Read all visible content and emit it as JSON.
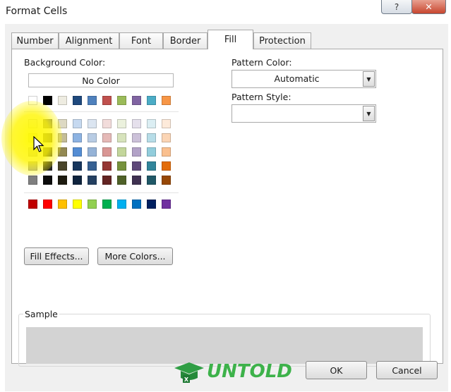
{
  "window": {
    "title": "Format Cells",
    "help_label": "?",
    "close_label": "✕"
  },
  "tabs": [
    {
      "label": "Number",
      "active": false
    },
    {
      "label": "Alignment",
      "active": false
    },
    {
      "label": "Font",
      "active": false
    },
    {
      "label": "Border",
      "active": false
    },
    {
      "label": "Fill",
      "active": true
    },
    {
      "label": "Protection",
      "active": false
    }
  ],
  "fill": {
    "background_color_label": "Background Color:",
    "no_color_label": "No Color",
    "theme_colors_top": [
      "#ffffff",
      "#000000",
      "#eeece1",
      "#1f497d",
      "#4f81bd",
      "#c0504d",
      "#9bbb59",
      "#8064a2",
      "#4bacc6",
      "#f79646"
    ],
    "theme_shades": [
      [
        "#f2f2f2",
        "#7f7f7f",
        "#ddd9c3",
        "#c6d9f0",
        "#dbe5f1",
        "#f2dcdb",
        "#ebf1dd",
        "#e5e0ec",
        "#dbeef3",
        "#fdeada"
      ],
      [
        "#d8d8d8",
        "#595959",
        "#c4bd97",
        "#8db3e2",
        "#b8cce4",
        "#e5b9b7",
        "#d7e3bc",
        "#ccc1d9",
        "#b7dde8",
        "#fbd5b5"
      ],
      [
        "#bfbfbf",
        "#3f3f3f",
        "#938953",
        "#548dd4",
        "#95b3d7",
        "#d99694",
        "#c3d69b",
        "#b2a2c7",
        "#92cddc",
        "#fac08f"
      ],
      [
        "#a5a5a5",
        "#262626",
        "#494429",
        "#17365d",
        "#366092",
        "#953734",
        "#76923c",
        "#5f497a",
        "#31859b",
        "#e36c09"
      ],
      [
        "#7f7f7f",
        "#0c0c0c",
        "#1d1b10",
        "#0f243e",
        "#244061",
        "#632423",
        "#4f6128",
        "#3f3151",
        "#205867",
        "#974806"
      ]
    ],
    "standard_colors": [
      "#c00000",
      "#ff0000",
      "#ffc000",
      "#ffff00",
      "#92d050",
      "#00b050",
      "#00b0f0",
      "#0070c0",
      "#002060",
      "#7030a0"
    ],
    "fill_effects_label": "Fill Effects...",
    "more_colors_label": "More Colors...",
    "pattern_color_label": "Pattern Color:",
    "pattern_color_value": "Automatic",
    "pattern_style_label": "Pattern Style:",
    "pattern_style_value": "",
    "sample_label": "Sample",
    "sample_color": "#d3d3d3"
  },
  "buttons": {
    "ok_label": "OK",
    "cancel_label": "Cancel"
  },
  "watermark": {
    "brand_text": "UNTOLD"
  }
}
